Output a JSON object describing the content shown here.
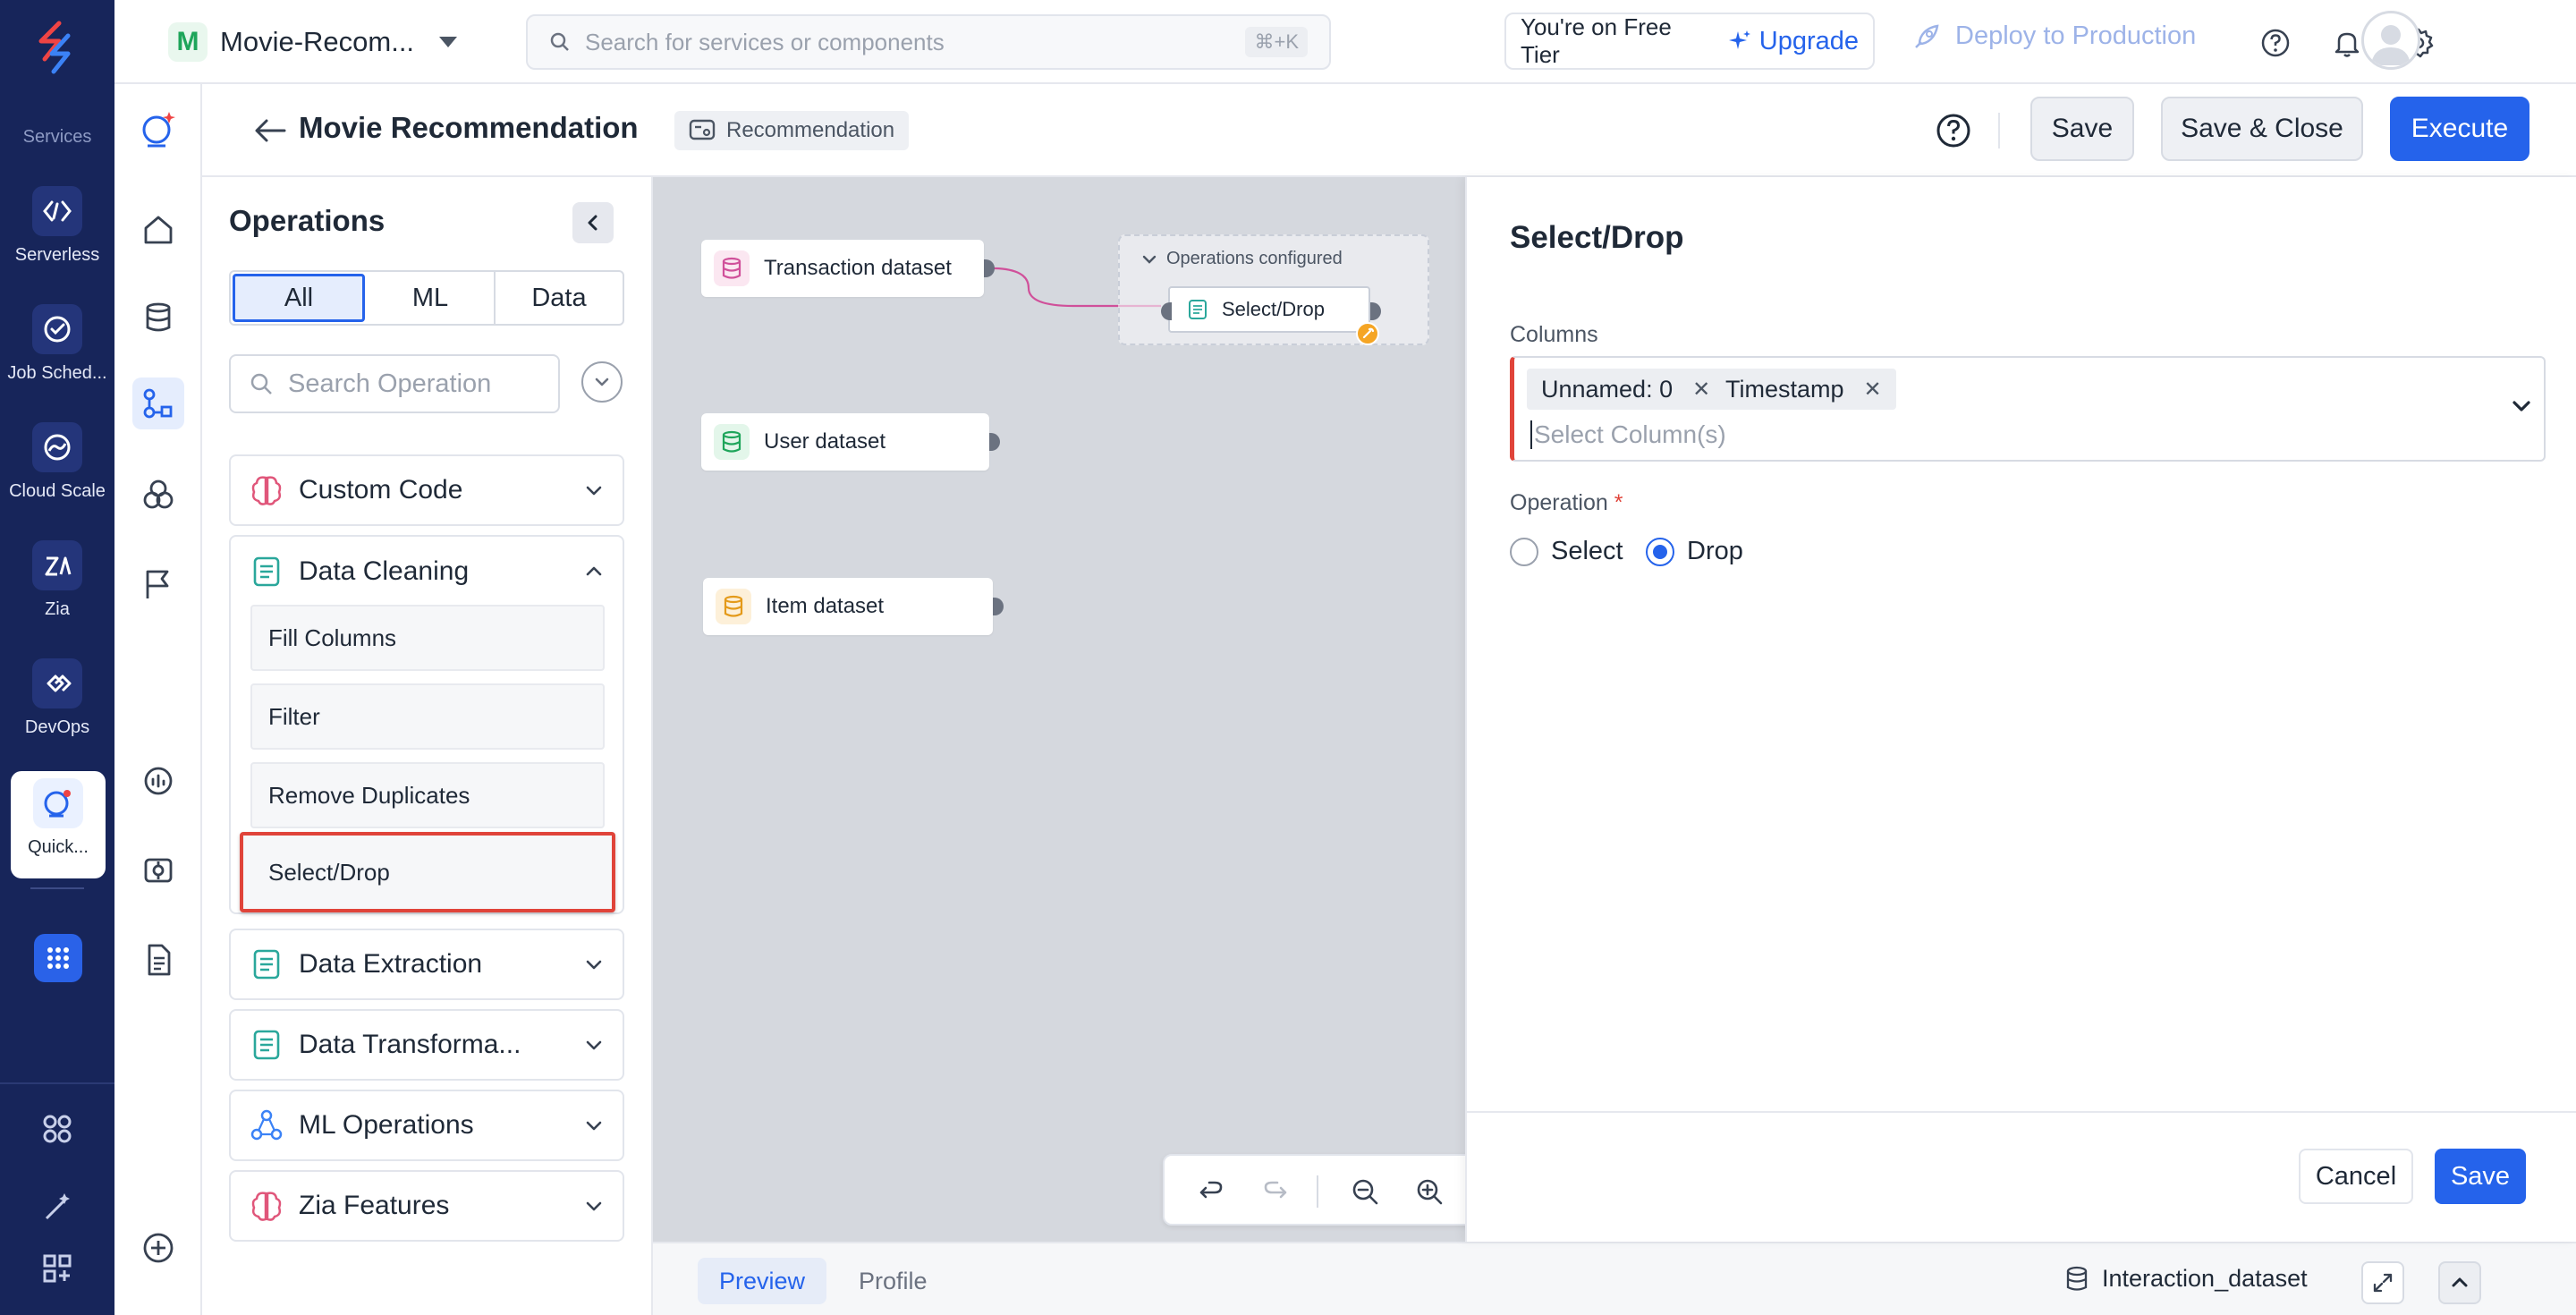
{
  "rail": {
    "section_label": "Services",
    "items": [
      {
        "label": "Serverless",
        "icon": "serverless-icon"
      },
      {
        "label": "Job Sched...",
        "icon": "job-scheduling-icon"
      },
      {
        "label": "Cloud Scale",
        "icon": "cloud-scale-icon"
      },
      {
        "label": "Zia",
        "icon": "zia-icon"
      },
      {
        "label": "DevOps",
        "icon": "devops-icon"
      },
      {
        "label": "Quick...",
        "icon": "quickml-icon",
        "active": true
      }
    ]
  },
  "topbar": {
    "project_initial": "M",
    "project_name": "Movie-Recom...",
    "search_placeholder": "Search for services or components",
    "search_shortcut": "⌘+K",
    "tier_text": "You're on Free Tier",
    "upgrade_label": "Upgrade",
    "deploy_label": "Deploy to Production"
  },
  "subheader": {
    "title": "Movie Recommendation",
    "tag": "Recommendation",
    "save_label": "Save",
    "save_close_label": "Save & Close",
    "execute_label": "Execute"
  },
  "operations": {
    "title": "Operations",
    "tabs": [
      "All",
      "ML",
      "Data"
    ],
    "active_tab": "All",
    "search_placeholder": "Search Operation",
    "categories": [
      {
        "label": "Custom Code",
        "expanded": false
      },
      {
        "label": "Data Cleaning",
        "expanded": true,
        "items": [
          "Fill Columns",
          "Filter",
          "Remove Duplicates",
          "Select/Drop"
        ],
        "highlighted": "Select/Drop"
      },
      {
        "label": "Data Extraction",
        "expanded": false
      },
      {
        "label": "Data Transforma...",
        "expanded": false
      },
      {
        "label": "ML Operations",
        "expanded": false
      },
      {
        "label": "Zia Features",
        "expanded": false
      }
    ]
  },
  "canvas": {
    "nodes": [
      "Transaction dataset",
      "User dataset",
      "Item dataset"
    ],
    "group_title": "Operations configured",
    "op_node": "Select/Drop"
  },
  "bottombar": {
    "tabs": [
      "Preview",
      "Profile"
    ],
    "active_tab": "Preview",
    "dataset": "Interaction_dataset"
  },
  "config": {
    "title": "Select/Drop",
    "columns_label": "Columns",
    "selected_columns": [
      "Unnamed: 0",
      "Timestamp"
    ],
    "columns_placeholder": "Select Column(s)",
    "operation_label": "Operation",
    "required_mark": "*",
    "options": [
      "Select",
      "Drop"
    ],
    "selected_option": "Drop",
    "cancel_label": "Cancel",
    "save_label": "Save"
  },
  "colors": {
    "rail_bg": "#17255a",
    "primary": "#2563eb",
    "highlight_border": "#e0443a"
  }
}
